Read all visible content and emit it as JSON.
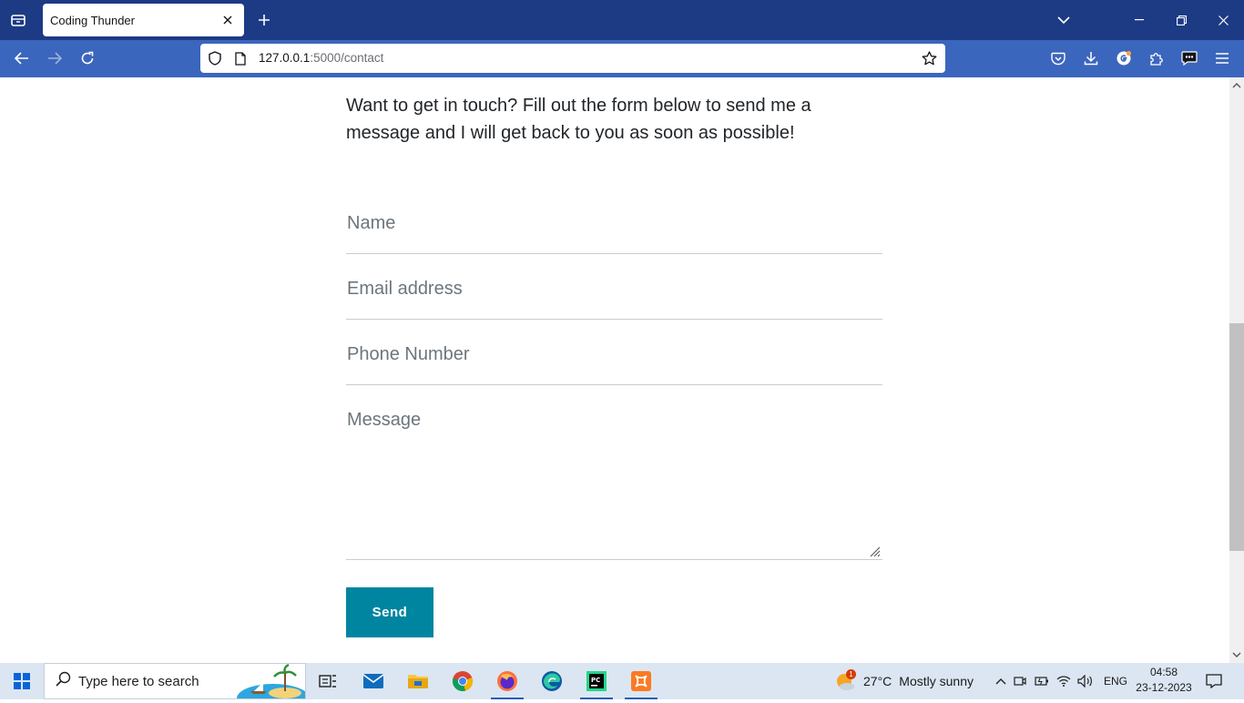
{
  "browser": {
    "tab_title": "Coding Thunder",
    "url_host": "127.0.0.1",
    "url_path": ":5000/contact"
  },
  "page": {
    "intro_text": "Want to get in touch? Fill out the form below to send me a message and I will get back to you as soon as possible!",
    "form": {
      "name_placeholder": "Name",
      "email_placeholder": "Email address",
      "phone_placeholder": "Phone Number",
      "message_placeholder": "Message",
      "send_label": "Send"
    },
    "accent_color": "#0085a1"
  },
  "taskbar": {
    "search_placeholder": "Type here to search",
    "weather_temp": "27°C",
    "weather_desc": "Mostly sunny",
    "weather_badge": "1",
    "language": "ENG",
    "time": "04:58",
    "date": "23-12-2023"
  }
}
